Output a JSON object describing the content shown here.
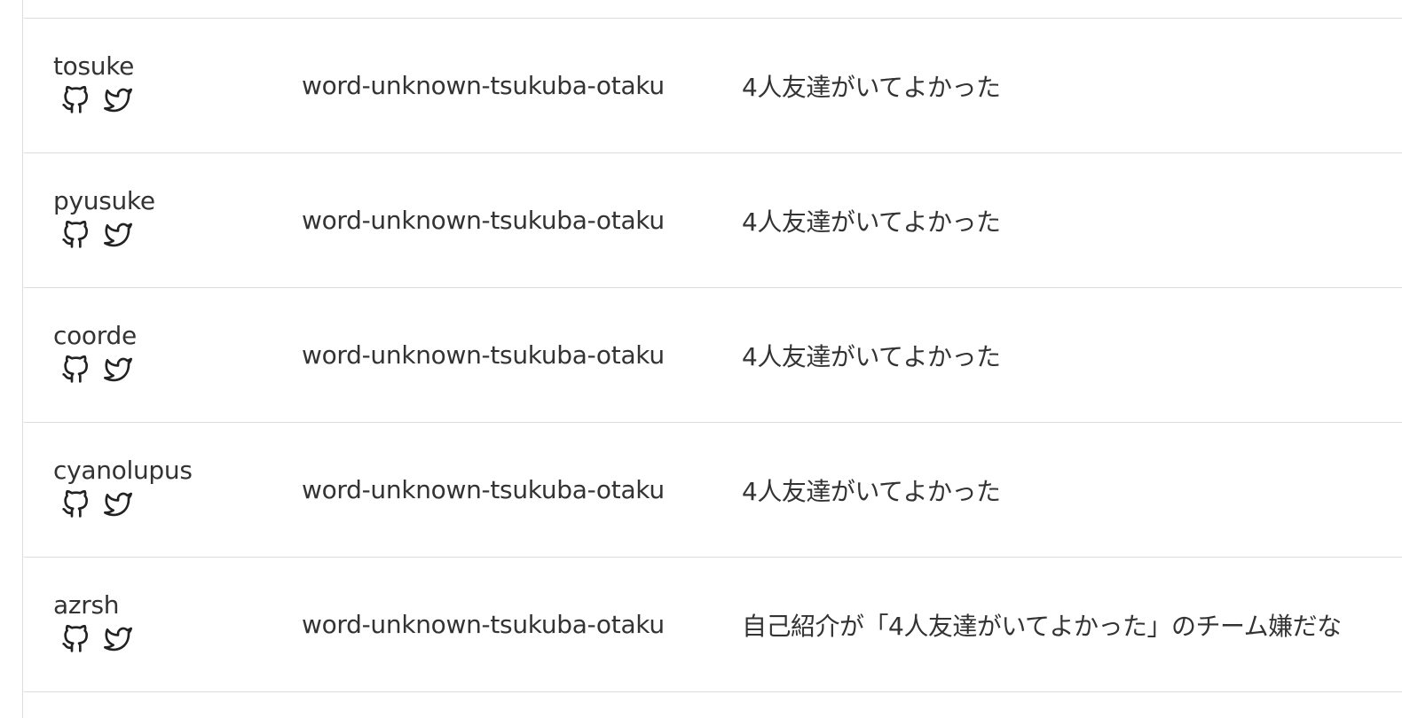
{
  "rows": [
    {
      "name": "tosuke",
      "team": "word-unknown-tsukuba-otaku",
      "comment": "4人友達がいてよかった"
    },
    {
      "name": "pyusuke",
      "team": "word-unknown-tsukuba-otaku",
      "comment": "4人友達がいてよかった"
    },
    {
      "name": "coorde",
      "team": "word-unknown-tsukuba-otaku",
      "comment": "4人友達がいてよかった"
    },
    {
      "name": "cyanolupus",
      "team": "word-unknown-tsukuba-otaku",
      "comment": "4人友達がいてよかった"
    },
    {
      "name": "azrsh",
      "team": "word-unknown-tsukuba-otaku",
      "comment": "自己紹介が「4人友達がいてよかった」のチーム嫌だな"
    }
  ],
  "icons": {
    "github": "github-icon",
    "twitter": "twitter-icon"
  },
  "colors": {
    "text": "#333333",
    "border": "#dcdcdc",
    "icon": "#222222"
  }
}
